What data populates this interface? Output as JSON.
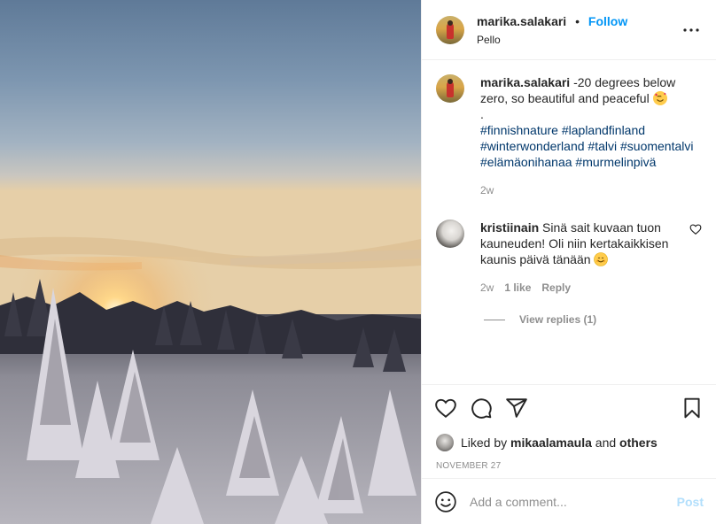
{
  "photo": {
    "description_icon": "landscape-photo"
  },
  "header": {
    "username": "marika.salakari",
    "separator": "•",
    "follow_label": "Follow",
    "location": "Pello",
    "more_icon": "more-horizontal-icon"
  },
  "caption": {
    "username": "marika.salakari",
    "text": "-20 degrees below zero, so beautiful and peaceful",
    "emoji": "smiling-face-with-hearts",
    "dot": ".",
    "hashtags": [
      "#finnishnature",
      "#laplandfinland",
      "#winterwonderland",
      "#talvi",
      "#suomentalvi",
      "#elämäonihanaa",
      "#murmelinpivä"
    ],
    "time": "2w"
  },
  "comment": {
    "username": "kristiinain",
    "text": "Sinä sait kuvaan tuon kauneuden! Oli niin kertakaikkisen kaunis päivä tänään",
    "emoji": "smiling-face",
    "time": "2w",
    "likes": "1 like",
    "reply_label": "Reply",
    "view_replies": "View replies (1)"
  },
  "actions": {
    "like_icon": "heart-icon",
    "comment_icon": "comment-icon",
    "share_icon": "share-icon",
    "save_icon": "bookmark-icon"
  },
  "likes": {
    "prefix": "Liked by",
    "user": "mikaalamaula",
    "and": "and",
    "others": "others"
  },
  "date": "NOVEMBER 27",
  "add_comment": {
    "placeholder": "Add a comment...",
    "post_label": "Post"
  },
  "colors": {
    "link": "#0095f6",
    "hashtag": "#00376b",
    "muted": "#8e8e8e",
    "post_disabled": "#b2dffc"
  }
}
